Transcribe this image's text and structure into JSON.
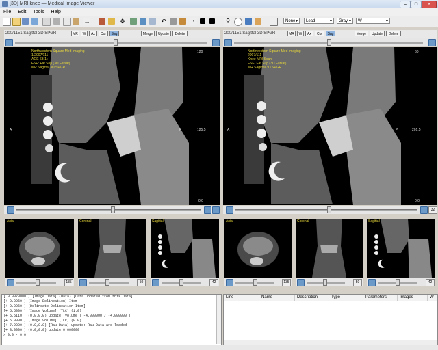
{
  "window": {
    "title": "[3D] MRI knee — Medical Image Viewer"
  },
  "menu": [
    "File",
    "Edit",
    "Tools",
    "Help"
  ],
  "toolbar": {
    "combo1": "None",
    "combo2": "Lead",
    "combo3": "Gray",
    "combo4": "W"
  },
  "panels": {
    "left": {
      "header": "200/1151 Sagittal 3D SPGR",
      "buttons": [
        "MR",
        "W",
        "Ax",
        "Cor",
        "Sag"
      ],
      "right_buttons": [
        "Merge",
        "Update",
        "Delete"
      ],
      "overlay_lines": [
        "Northwestern Square Med Imaging",
        "1/2007/111",
        "AGE 63(1)",
        "FSE: Fat Sup (3D Fatsat)",
        "MR Sagittal 3D SPGR"
      ],
      "marker_top": "120",
      "marker_mid": "125.5",
      "marker_bottom": "0.0",
      "letter_a": "A",
      "letter_p": "P"
    },
    "right": {
      "header": "200/1151 Sagittal 3D SPGR",
      "buttons": [
        "MR",
        "W",
        "Ax",
        "Cor",
        "Sag"
      ],
      "right_buttons": [
        "Merge",
        "Update",
        "Delete"
      ],
      "overlay_lines": [
        "Northwestern Square Med Imaging",
        "2007/111",
        "Knee MRI Scan",
        "FSE: Fat Sup (3D Fatsat)",
        "MR Sagittal 3D SPGR"
      ],
      "marker_top": "60",
      "marker_mid": "201.5",
      "marker_bottom": "0.0",
      "letter_a": "A",
      "letter_p": "P"
    }
  },
  "thumbs": {
    "left": [
      {
        "label": "Axial",
        "value": "135"
      },
      {
        "label": "Coronal",
        "value": "50"
      },
      {
        "label": "Sagittal",
        "value": "42"
      }
    ],
    "right": [
      {
        "label": "Axial",
        "value": "135"
      },
      {
        "label": "Coronal",
        "value": "50"
      },
      {
        "label": "Sagittal",
        "value": "42"
      }
    ]
  },
  "log": [
    "[ 0.0070000 ] [Image Data] (Data) [Data updated from this Data]",
    "[+ 0.0060 ] [Image Delineation] Item",
    "",
    "[+ 0.0060 ] [Delineate Delineation Item]",
    "[+ 5.5000 ] [Image Volume] [TLC] (1.0)",
    "[+ 5.5110 ] (0.0,0.0) update: Volume [ -4.000000 / -4.000000 ]",
    "[+ 5.0000 ] [Image Volume] [TLC] (0.0)",
    "[+ 7.2000 ] (0.0,0.0) [Raw Data] update: Raw Data are loaded",
    "",
    "[+ 8.0000 ] (0.0,0.0) update 0.000000",
    "> 0.0 · 0.0"
  ],
  "table": {
    "columns": [
      "Line",
      "Name",
      "Description",
      "Type",
      "Parameters",
      "Images",
      "W"
    ]
  },
  "colors": {
    "overlay": "#e8d83a",
    "accent": "#6b9ac9"
  }
}
